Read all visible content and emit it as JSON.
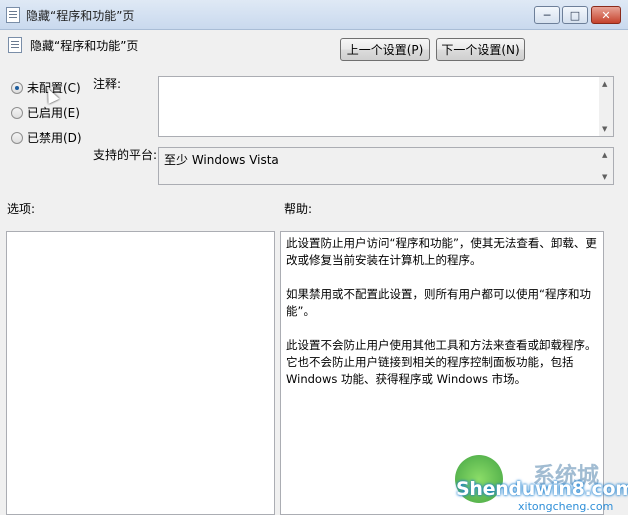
{
  "window": {
    "title": "隐藏“程序和功能”页",
    "min_glyph": "─",
    "max_glyph": "□",
    "close_glyph": "✕"
  },
  "header": {
    "policy_name": "隐藏“程序和功能”页",
    "prev_button": "上一个设置(P)",
    "next_button": "下一个设置(N)"
  },
  "state_options": [
    {
      "label": "未配置(C)",
      "checked": true
    },
    {
      "label": "已启用(E)",
      "checked": false
    },
    {
      "label": "已禁用(D)",
      "checked": false
    }
  ],
  "comment": {
    "label": "注释:",
    "value": ""
  },
  "platform": {
    "label": "支持的平台:",
    "value": "至少 Windows Vista"
  },
  "options": {
    "label": "选项:"
  },
  "help": {
    "label": "帮助:",
    "paragraphs": [
      "此设置防止用户访问“程序和功能”，使其无法查看、卸载、更改或修复当前安装在计算机上的程序。",
      "如果禁用或不配置此设置，则所有用户都可以使用“程序和功能”。",
      "此设置不会防止用户使用其他工具和方法来查看或卸载程序。它也不会防止用户链接到相关的程序控制面板功能，包括 Windows 功能、获得程序或 Windows 市场。"
    ]
  },
  "watermark": {
    "main": "Shenduwin8.com",
    "cn": "系统城",
    "sub": "xitongcheng.com"
  },
  "colors": {
    "title_bar": "#c9d9ee",
    "close_button": "#c5422c",
    "radio_dot": "#1d5d9e"
  }
}
